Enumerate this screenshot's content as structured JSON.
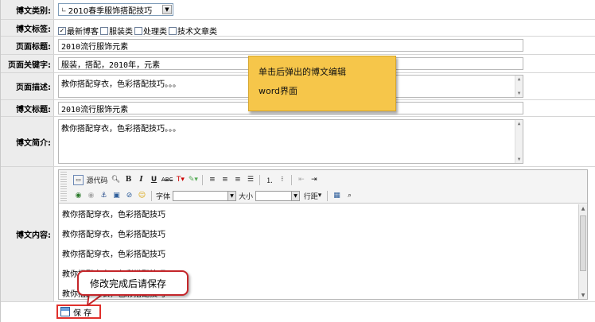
{
  "category": {
    "label": "博文类别:",
    "selected": "2010春季服饰搭配技巧"
  },
  "tags": {
    "label": "博文标签:",
    "options": [
      {
        "text": "最新博客",
        "checked": true
      },
      {
        "text": "服装类",
        "checked": false
      },
      {
        "text": "处理类",
        "checked": false
      },
      {
        "text": "技术文章类",
        "checked": false
      }
    ]
  },
  "page_title": {
    "label": "页面标题:",
    "value": "2010流行服饰元素"
  },
  "page_keywords": {
    "label": "页面关键字:",
    "value": "服装，搭配，2010年，元素"
  },
  "page_description": {
    "label": "页面描述:",
    "value": "教你搭配穿衣，色彩搭配技巧。。。"
  },
  "post_title": {
    "label": "博文标题:",
    "value": "2010流行服饰元素"
  },
  "post_summary": {
    "label": "博文简介:",
    "value": "教你搭配穿衣，色彩搭配技巧。。。"
  },
  "post_content": {
    "label": "博文内容:",
    "toolbar": {
      "source": "源代码",
      "font_label": "字体",
      "size_label": "大小",
      "line_spacing": "行距"
    },
    "paragraphs": [
      "教你搭配穿衣，色彩搭配技巧",
      "教你搭配穿衣，色彩搭配技巧",
      "教你搭配穿衣，色彩搭配技巧",
      "教你搭配穿衣，色彩搭配技巧",
      "教你搭配穿衣，色彩搭配技巧"
    ]
  },
  "save_button": "保 存",
  "note": {
    "line1": "单击后弹出的博文编辑",
    "line2": "word界面"
  },
  "callout": "修改完成后请保存",
  "colors": {
    "label_bg": "#ececec",
    "note_bg": "#f6c64a",
    "callout_border": "#c4262a",
    "save_border": "#e0302c"
  }
}
